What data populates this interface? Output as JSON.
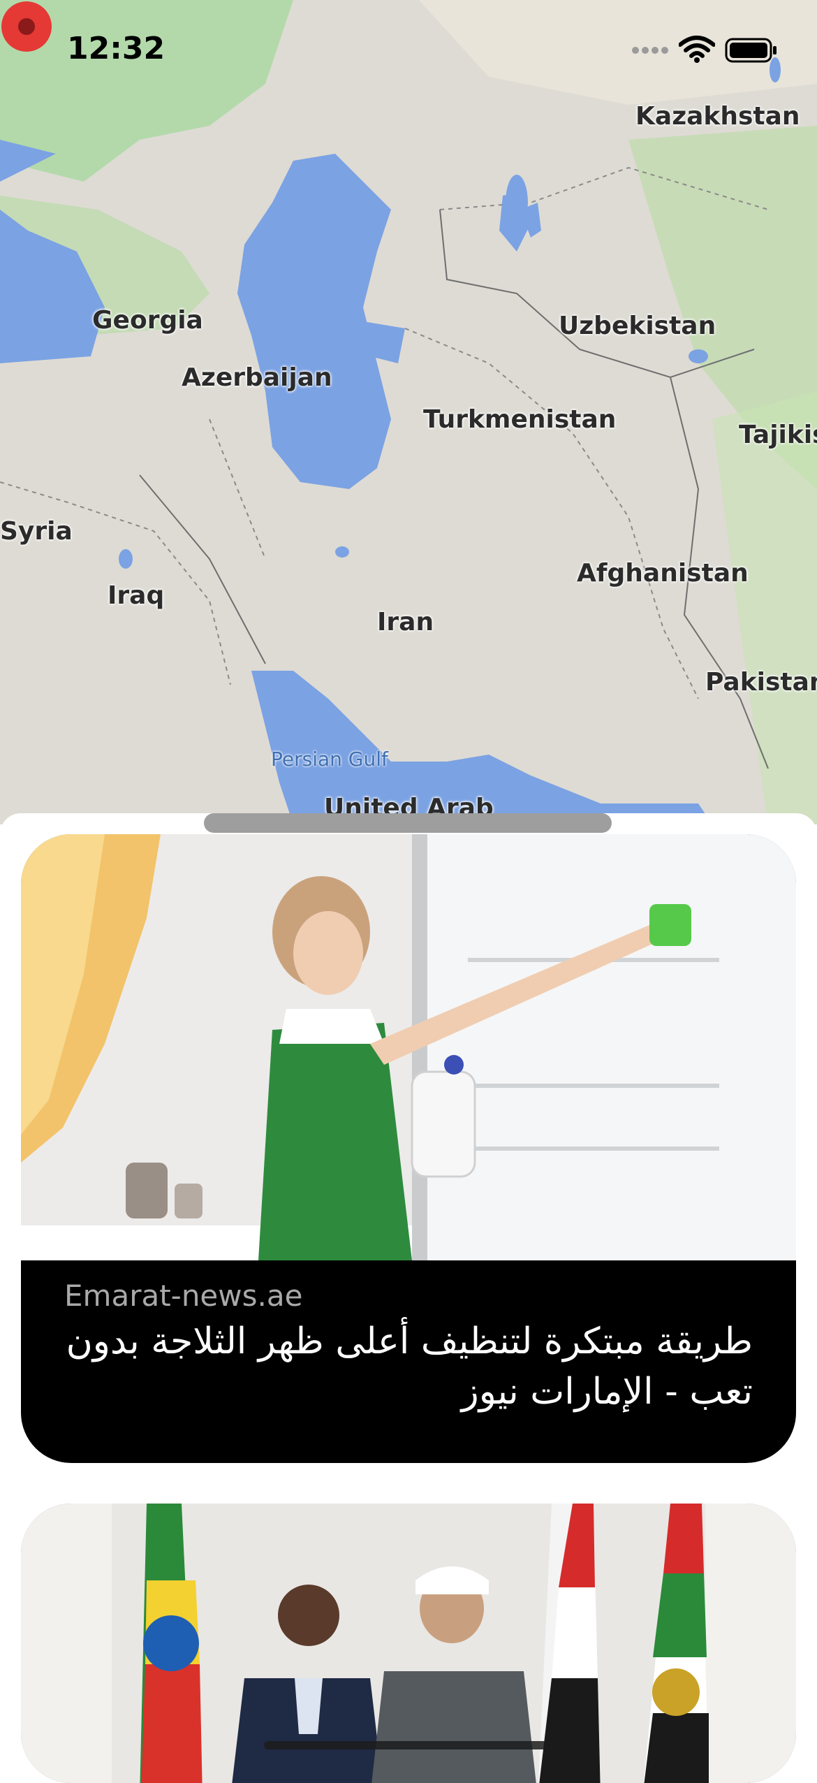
{
  "status_bar": {
    "time": "12:32"
  },
  "map": {
    "labels": {
      "kazakhstan": "Kazakhstan",
      "georgia": "Georgia",
      "uzbekistan": "Uzbekistan",
      "azerbaijan": "Azerbaijan",
      "turkmenistan": "Turkmenistan",
      "tajikistan": "Tajikis",
      "syria": "Syria",
      "afghanistan": "Afghanistan",
      "iraq": "Iraq",
      "iran": "Iran",
      "pakistan": "Pakistan",
      "persian_gulf": "Persian Gulf",
      "uae": "United Arab"
    }
  },
  "feed": {
    "cards": [
      {
        "source": "Emarat-news.ae",
        "headline": "طريقة مبتكرة لتنظيف أعلى ظهر الثلاجة بدون تعب - الإمارات نيوز"
      },
      {
        "source": "",
        "headline": ""
      }
    ]
  },
  "colors": {
    "water": "#7ba2e3",
    "land": "#dedbd4",
    "green": "#a8d8a0",
    "card_bg": "#000000",
    "pin": "#e53935"
  }
}
